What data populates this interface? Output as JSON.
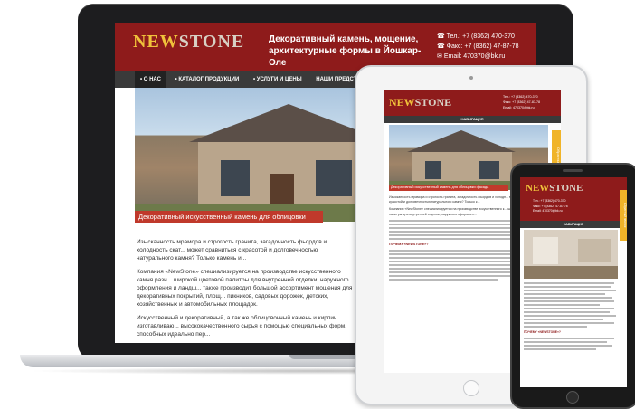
{
  "laptop": {
    "logo_new": "NEW",
    "logo_stone": "STONE",
    "tagline": "Декоративный камень, мощение, архитектурные формы в Йошкар-Оле",
    "contacts": {
      "tel": "Тел.: +7 (8362) 470-370",
      "fax": "Факс: +7 (8362) 47-87-78",
      "email": "Email: 470370@bk.ru"
    },
    "nav": [
      "• О НАС",
      "• КАТАЛОГ ПРОДУКЦИИ",
      "• УСЛУГИ И ЦЕНЫ",
      "НАШИ ПРЕДСТАВИТ"
    ],
    "hero_caption": "Декоративный искусственный камень для облицовки фасада",
    "paragraphs": [
      "Изысканность мрамора и строгость гранита, загадочность фьордов и холодность скат... может сравниться с красотой и долговечностью натурального камня? Только камень и...",
      "Компания «NewStone» специализируется на производстве искусственного камня разн... широкой цветовой палитры для внутренней отделки, наружного оформления и ландш... также производит большой ассортимент мощения для декоративных покрытий, площ... пикников, садовых дорожек, детских, хозяйственных и автомобильных площадок.",
      "Искусственный и декоративный, а так же облицовочный камень и кирпич изготавливаю... высококачественного сырья с помощью специальных форм, способных идеально пер..."
    ]
  },
  "tablet": {
    "logo_new": "NEW",
    "logo_stone": "STONE",
    "contacts": [
      "Тел.: +7 (8362) 470-370",
      "Факс: +7 (8362) 47-87-78",
      "Email: 470370@bk.ru"
    ],
    "nav_label": "НАВИГАЦИЯ",
    "hero_caption": "Декоративный искусственный камень для облицовки фасада",
    "paragraphs": [
      "Изысканность мрамора и строгость гранита, загадочность фьордов и холодн... может сравниться с красотой и долговечностью натурального камня? Только к...",
      "Компания «NewStone» специализируется на производстве искусственного к... широкой цветовой палитры для внутренней отделки, наружного оформлен..."
    ],
    "section_heading": "ПОЧЕМУ «NEWSTONE»?",
    "side_tab": "Обратный звонок",
    "footer_note": "«NewSton"
  },
  "phone": {
    "logo_new": "NEW",
    "logo_stone": "STONE",
    "contacts": [
      "Тел.: +7 (8362) 470-370",
      "Факс: +7 (8362) 47-87-78",
      "Email: 470370@bk.ru"
    ],
    "nav_label": "НАВИГАЦИЯ",
    "section_heading": "ПОЧЕМУ «NEWSTONE»?",
    "side_tab": "Обратный звонок"
  },
  "colors": {
    "brand_red": "#8e1b1b",
    "accent_gold": "#f0b429",
    "nav_dark": "#3a3a3a"
  }
}
